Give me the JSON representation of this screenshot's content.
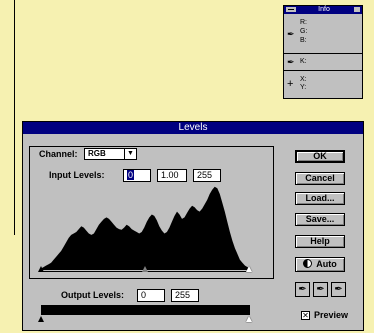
{
  "info_palette": {
    "title": "Info",
    "rgb_labels": [
      "R:",
      "G:",
      "B:"
    ],
    "k_label": "K:",
    "xy_labels": [
      "X:",
      "Y:"
    ]
  },
  "levels": {
    "title": "Levels",
    "channel_label": "Channel:",
    "channel_value": "RGB",
    "input_levels_label": "Input Levels:",
    "input_black": "0",
    "input_gamma": "1.00",
    "input_white": "255",
    "output_levels_label": "Output Levels:",
    "output_black": "0",
    "output_white": "255",
    "buttons": {
      "ok": "OK",
      "cancel": "Cancel",
      "load": "Load...",
      "save": "Save...",
      "help": "Help",
      "auto": "Auto"
    },
    "preview_label": "Preview",
    "preview_checked": true
  },
  "histogram": [
    2,
    4,
    6,
    8,
    10,
    14,
    18,
    22,
    26,
    32,
    38,
    44,
    48,
    50,
    52,
    56,
    60,
    58,
    54,
    50,
    48,
    50,
    56,
    62,
    66,
    70,
    72,
    70,
    66,
    62,
    58,
    56,
    55,
    58,
    62,
    60,
    56,
    54,
    52,
    50,
    52,
    58,
    66,
    72,
    76,
    74,
    68,
    60,
    54,
    50,
    52,
    58,
    66,
    74,
    80,
    76,
    70,
    72,
    78,
    84,
    88,
    86,
    82,
    80,
    84,
    90,
    96,
    104,
    110,
    114,
    112,
    104,
    92,
    80,
    66,
    52,
    40,
    30,
    22,
    14,
    10,
    6,
    4,
    2
  ],
  "colors": {
    "background": "#f6f1b1",
    "titlebar": "#000080",
    "window": "#c0c0c0"
  }
}
